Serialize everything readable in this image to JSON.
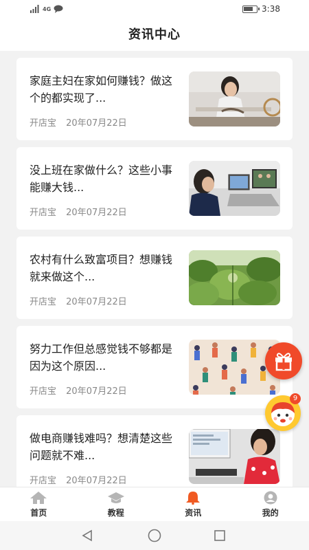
{
  "status": {
    "time": "3:38",
    "network": "4G",
    "battery_level": 0.8
  },
  "header": {
    "title": "资讯中心"
  },
  "articles": [
    {
      "title": "家庭主妇在家如何赚钱？做这个的都实现了...",
      "source": "开店宝",
      "date": "20年07月22日",
      "image": "woman-sewing"
    },
    {
      "title": "没上班在家做什么？这些小事能赚大钱...",
      "source": "开店宝",
      "date": "20年07月22日",
      "image": "woman-laptops"
    },
    {
      "title": "农村有什么致富项目？想赚钱就来做这个...",
      "source": "开店宝",
      "date": "20年07月22日",
      "image": "greenhouse-plants"
    },
    {
      "title": "努力工作但总感觉钱不够都是因为这个原因...",
      "source": "开店宝",
      "date": "20年07月22日",
      "image": "crowd-illustration"
    },
    {
      "title": "做电商赚钱难吗？想清楚这些问题就不难...",
      "source": "开店宝",
      "date": "20年07月22日",
      "image": "woman-computer-desk"
    }
  ],
  "tabbar": {
    "items": [
      {
        "label": "首页",
        "icon": "home-icon",
        "active": false
      },
      {
        "label": "教程",
        "icon": "graduation-cap-icon",
        "active": false
      },
      {
        "label": "资讯",
        "icon": "bell-icon",
        "active": true
      },
      {
        "label": "我的",
        "icon": "user-icon",
        "active": false
      }
    ]
  },
  "floating": {
    "gift_icon": "gift-icon",
    "avatar_icon": "cartoon-avatar-icon",
    "badge_count": "9"
  },
  "colors": {
    "accent": "#f04a2a",
    "active_tab": "#f05a22",
    "inactive_tab": "#b5b5b5"
  }
}
